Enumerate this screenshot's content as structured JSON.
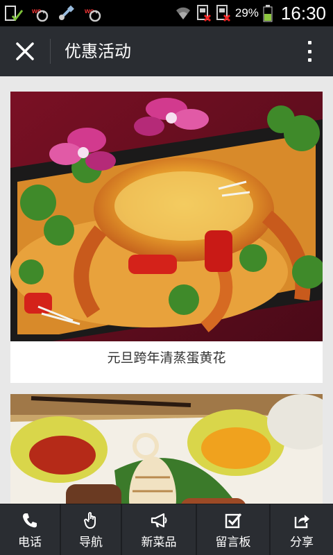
{
  "status_bar": {
    "battery": "29%",
    "time": "16:30"
  },
  "header": {
    "title": "优惠活动"
  },
  "cards": [
    {
      "caption": "元旦跨年清蒸蛋黄花"
    },
    {
      "caption": ""
    }
  ],
  "bottom_nav": {
    "items": [
      {
        "label": "电话",
        "icon": "phone-icon"
      },
      {
        "label": "导航",
        "icon": "hand-pointer-icon"
      },
      {
        "label": "新菜品",
        "icon": "megaphone-icon"
      },
      {
        "label": "留言板",
        "icon": "checkbox-icon"
      },
      {
        "label": "分享",
        "icon": "share-icon"
      }
    ]
  }
}
